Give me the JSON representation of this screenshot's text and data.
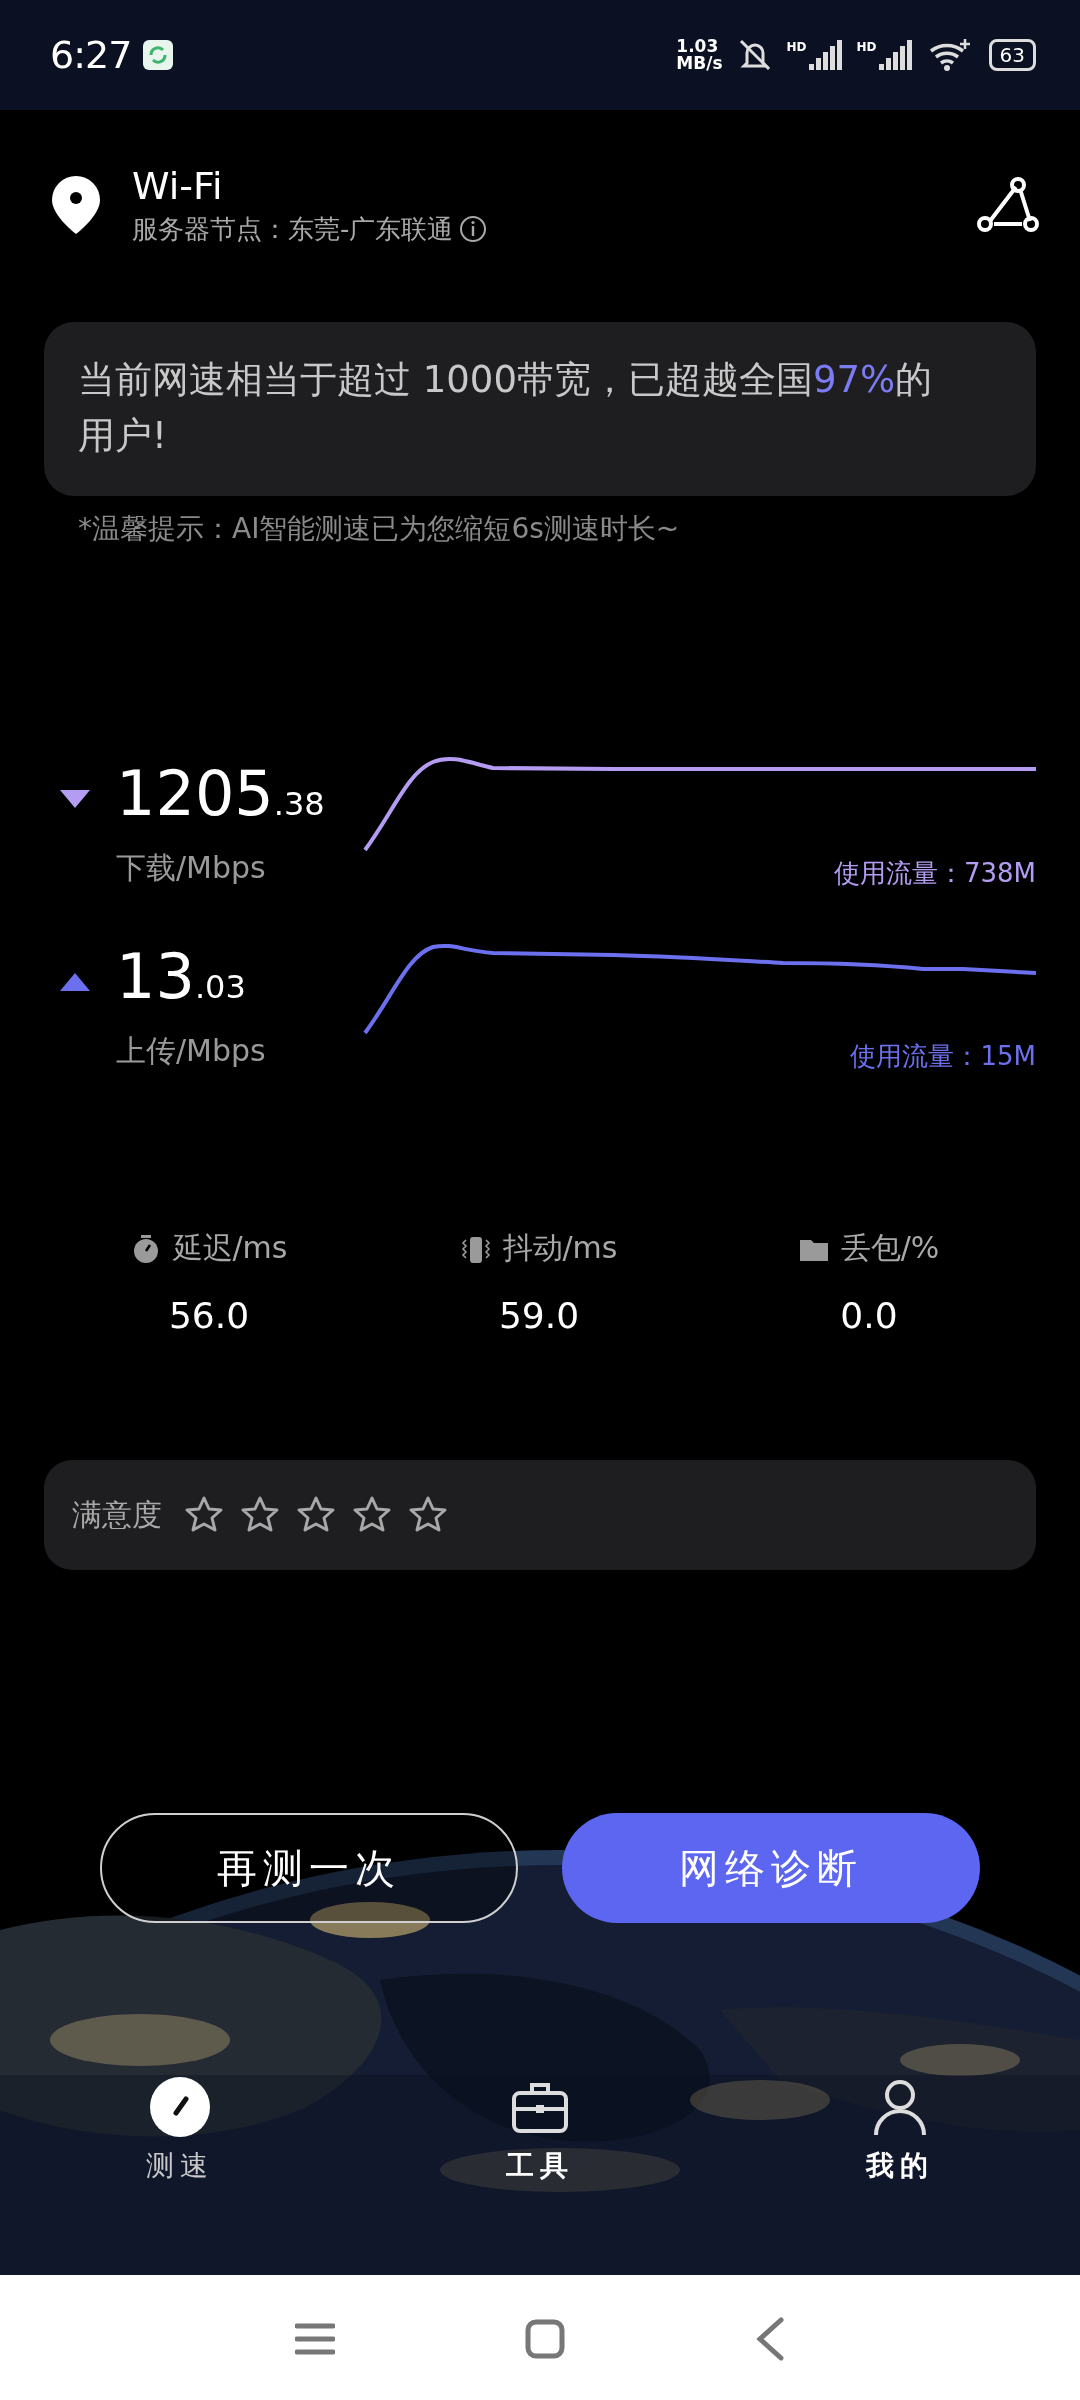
{
  "status_bar": {
    "time": "6:27",
    "net_speed": [
      "1.03",
      "MB/s"
    ],
    "signals": [
      "HD",
      "HD"
    ],
    "battery": "63"
  },
  "header": {
    "title": "Wi-Fi",
    "server": "服务器节点：东莞-广东联通"
  },
  "summary": {
    "before": "当前网速相当于超过 1000带宽，已超越全国",
    "highlight": "97%",
    "after": "的用户!"
  },
  "hint": "*温馨提示：AI智能测速已为您缩短6s测速时长~",
  "speeds": [
    {
      "kind": "download",
      "value": "1205",
      "decimals": ".38",
      "unit": "下载/Mbps",
      "usage": "使用流量：738M",
      "color": "#b49cf2"
    },
    {
      "kind": "upload",
      "value": "13",
      "decimals": ".03",
      "unit": "上传/Mbps",
      "usage": "使用流量：15M",
      "color": "#6c70ee"
    }
  ],
  "stats": [
    {
      "kind": "timer",
      "label": "延迟/ms",
      "value": "56.0"
    },
    {
      "kind": "vibrate",
      "label": "抖动/ms",
      "value": "59.0"
    },
    {
      "kind": "folder",
      "label": "丢包/%",
      "value": "0.0"
    }
  ],
  "rating": {
    "label": "满意度",
    "stars": 0
  },
  "buttons": [
    {
      "kind": "outline",
      "label": "再测一次"
    },
    {
      "kind": "filled",
      "label": "网络诊断"
    }
  ],
  "nav": [
    {
      "kind": "speed",
      "label": "测速",
      "selected": true
    },
    {
      "kind": "toolbox",
      "label": "工具",
      "selected": false
    },
    {
      "kind": "person",
      "label": "我的",
      "selected": false
    }
  ]
}
